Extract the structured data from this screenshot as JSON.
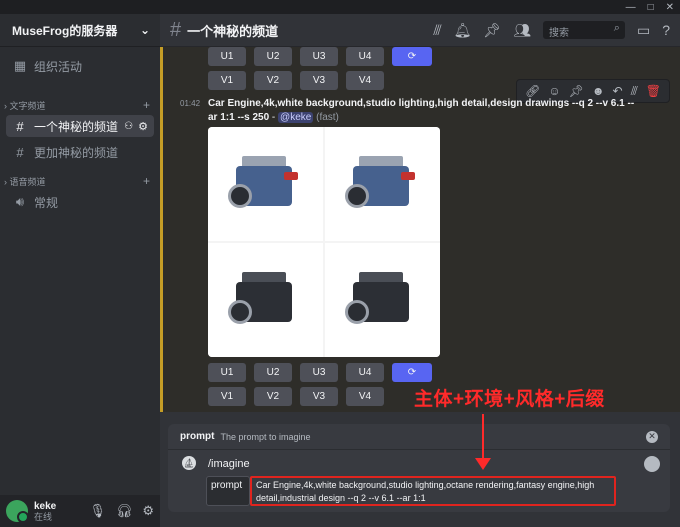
{
  "server": {
    "name": "MuseFrog的服务器"
  },
  "sidebar": {
    "events_label": "组织活动",
    "text_category": "文字频道",
    "text_channels": [
      {
        "label": "一个神秘的频道"
      },
      {
        "label": "更加神秘的频道"
      }
    ],
    "voice_category": "语音频道",
    "voice_channels": [
      {
        "label": "常规"
      }
    ]
  },
  "user": {
    "name": "keke",
    "status": "在线"
  },
  "header": {
    "channel": "一个神秘的频道",
    "search_placeholder": "搜索"
  },
  "buttons": {
    "u_row": [
      "U1",
      "U2",
      "U3",
      "U4"
    ],
    "v_row": [
      "V1",
      "V2",
      "V3",
      "V4"
    ]
  },
  "message": {
    "time": "01:42",
    "prompt": "Car Engine,4k,white background,studio lighting,high detail,design drawings --q 2 --v 6.1 --ar 1:1 --s 250",
    "separator": " - ",
    "mention": "@keke",
    "speed": "(fast)"
  },
  "command": {
    "option_name": "prompt",
    "option_desc": "The prompt to imagine",
    "name": "/imagine",
    "param_label": "prompt",
    "param_value": "Car Engine,4k,white background,studio lighting,octane rendering,fantasy engine,high detail,industrial design --q 2 --v 6.1 --ar 1:1"
  },
  "annotation": {
    "text": "主体+环境+风格+后缀",
    "color": "#ff2a2a"
  },
  "colors": {
    "accent": "#c59d26",
    "brand": "#5865f2",
    "danger": "#f23f42"
  }
}
